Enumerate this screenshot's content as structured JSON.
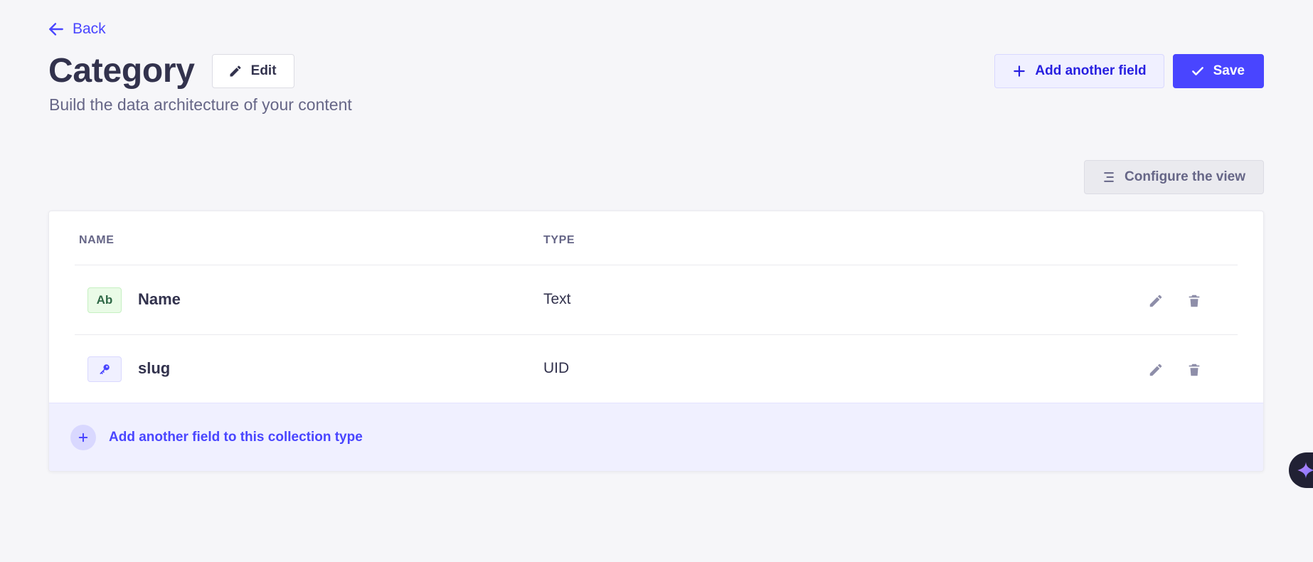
{
  "nav": {
    "back_label": "Back"
  },
  "header": {
    "title": "Category",
    "edit_label": "Edit",
    "subtitle": "Build the data architecture of your content",
    "add_field_label": "Add another field",
    "save_label": "Save"
  },
  "configure_view_label": "Configure the view",
  "table": {
    "columns": {
      "name": "NAME",
      "type": "TYPE"
    },
    "rows": [
      {
        "icon_label": "Ab",
        "icon": "text-type-icon",
        "name": "Name",
        "type": "Text"
      },
      {
        "icon_label": "",
        "icon": "key-icon",
        "name": "slug",
        "type": "UID"
      }
    ],
    "add_footer_label": "Add another field to this collection type"
  },
  "colors": {
    "primary": "#4945ff",
    "primary_light": "#f0f0ff",
    "text_dark": "#32324d",
    "text_muted": "#666687",
    "background": "#f6f6f9",
    "text_type_bg": "#eafbe7",
    "text_type_fg": "#2f6846"
  }
}
